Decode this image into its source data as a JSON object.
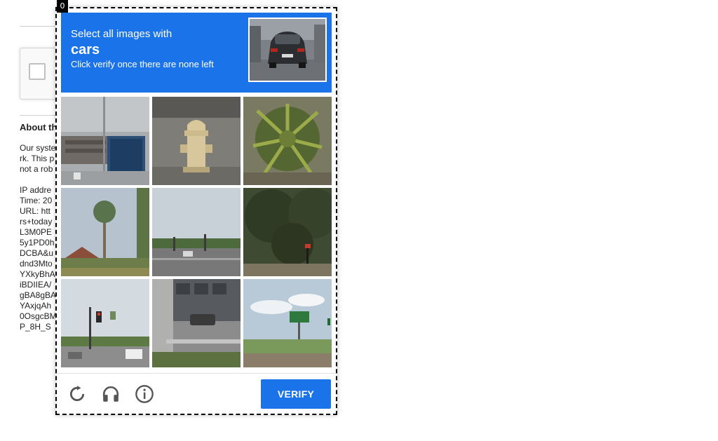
{
  "frame_index": "0",
  "background": {
    "about_heading": "About th",
    "text_lines": [
      "Our syste",
      "rk. This p",
      "not a rob",
      "",
      "IP addre",
      "Time: 20",
      "URL: htt",
      "rs+today",
      "L3M0PE",
      "5y1PD0h",
      "DCBA&u",
      "dnd3Mto",
      "YXkyBhA",
      "iBDIIEA/",
      "gBA8gBA",
      "YAxjqAh",
      "0OsgcBM",
      "P_8H_S"
    ]
  },
  "challenge": {
    "instruction_line1": "Select all images with",
    "target": "cars",
    "instruction_line3": "Click verify once there are none left",
    "tiles": [
      {
        "name": "tile-1",
        "scene": "building-container"
      },
      {
        "name": "tile-2",
        "scene": "fire-hydrant"
      },
      {
        "name": "tile-3",
        "scene": "palm-plant"
      },
      {
        "name": "tile-4",
        "scene": "palm-tree-roof"
      },
      {
        "name": "tile-5",
        "scene": "road-intersection"
      },
      {
        "name": "tile-6",
        "scene": "trees-traffic-light"
      },
      {
        "name": "tile-7",
        "scene": "street-traffic-lights"
      },
      {
        "name": "tile-8",
        "scene": "wall-car"
      },
      {
        "name": "tile-9",
        "scene": "highway-sign"
      }
    ],
    "controls": {
      "reload_icon": "reload-icon",
      "audio_icon": "headphones-icon",
      "info_icon": "info-icon",
      "verify_label": "VERIFY"
    }
  },
  "colors": {
    "accent": "#1a73e8",
    "frame_border": "#000000"
  }
}
